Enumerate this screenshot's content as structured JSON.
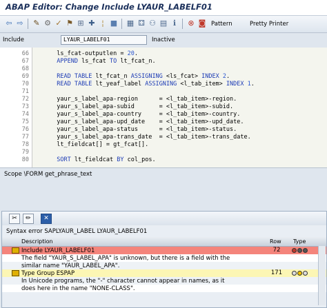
{
  "window": {
    "title": "ABAP Editor: Change Include LYAUR_LABELF01"
  },
  "toolbar": {
    "icons": [
      "back-arrow-icon",
      "forward-arrow-icon",
      "display-change-icon",
      "active-inactive-icon",
      "check-icon",
      "activate-icon",
      "test-icon",
      "where-used-icon",
      "object-list-icon",
      "navigation-window-icon",
      "enhancement-icon",
      "help-icon",
      "breakpoint-icon",
      "set-breakpoint-icon"
    ],
    "pattern_label": "Pattern",
    "pretty_printer_label": "Pretty Printer"
  },
  "include_row": {
    "label": "Include",
    "value": "LYAUR_LABELF01",
    "status": "Inactive"
  },
  "editor": {
    "lines": [
      {
        "n": "66",
        "text": "  ls_fcat-outputlen = 20."
      },
      {
        "n": "67",
        "text": "  APPEND ls_fcat TO lt_fcat_n."
      },
      {
        "n": "68",
        "text": ""
      },
      {
        "n": "69",
        "text": "  READ TABLE lt_fcat_n ASSIGNING <ls_fcat> INDEX 2."
      },
      {
        "n": "70",
        "text": "  READ TABLE lt_yeaf_label ASSIGNING <l_tab_item> INDEX 1."
      },
      {
        "n": "71",
        "text": ""
      },
      {
        "n": "72",
        "text": "  yaur_s_label_apa-region      = <l_tab_item>-region."
      },
      {
        "n": "73",
        "text": "  yaur_s_label_apa-subid       = <l_tab_item>-subid."
      },
      {
        "n": "74",
        "text": "  yaur_s_label_apa-country     = <l_tab_item>-country."
      },
      {
        "n": "75",
        "text": "  yaur_s_label_apa-upd_date    = <l_tab_item>-upd_date."
      },
      {
        "n": "76",
        "text": "  yaur_s_label_apa-status      = <l_tab_item>-status."
      },
      {
        "n": "77",
        "text": "  yaur_s_label_apa-trans_date  = <l_tab_item>-trans_date."
      },
      {
        "n": "78",
        "text": "  lt_fieldcat[] = gt_fcat[]."
      },
      {
        "n": "79",
        "text": ""
      },
      {
        "n": "80",
        "text": "  SORT lt_fieldcat BY col_pos."
      }
    ]
  },
  "scope": {
    "text": "Scope \\FORM get_phrase_text"
  },
  "error_panel": {
    "syntax_error": "Syntax error SAPLYAUR_LABEL LYAUR_LABELF01",
    "columns": {
      "description": "Description",
      "row": "Row",
      "type": "Type"
    },
    "rows": [
      {
        "text": "Include LYAUR_LABELF01",
        "row": "72",
        "kind": "error-header"
      },
      {
        "text": "The field \"YAUR_S_LABEL_APA\" is unknown, but there is a field with the",
        "row": "",
        "kind": "detail"
      },
      {
        "text": "similar name \"YAUR_LABEL_APA\".",
        "row": "",
        "kind": "detail"
      },
      {
        "text": "Type Group ESPAP",
        "row": "171",
        "kind": "warning-header"
      },
      {
        "text": "In Unicode programs, the \"-\" character cannot appear in names, as it",
        "row": "",
        "kind": "detail"
      },
      {
        "text": "does here in the name \"NONE-CLASS\".",
        "row": "",
        "kind": "detail"
      }
    ],
    "colors": {
      "error": "#f4847b",
      "warning": "#fcf6b4"
    }
  }
}
